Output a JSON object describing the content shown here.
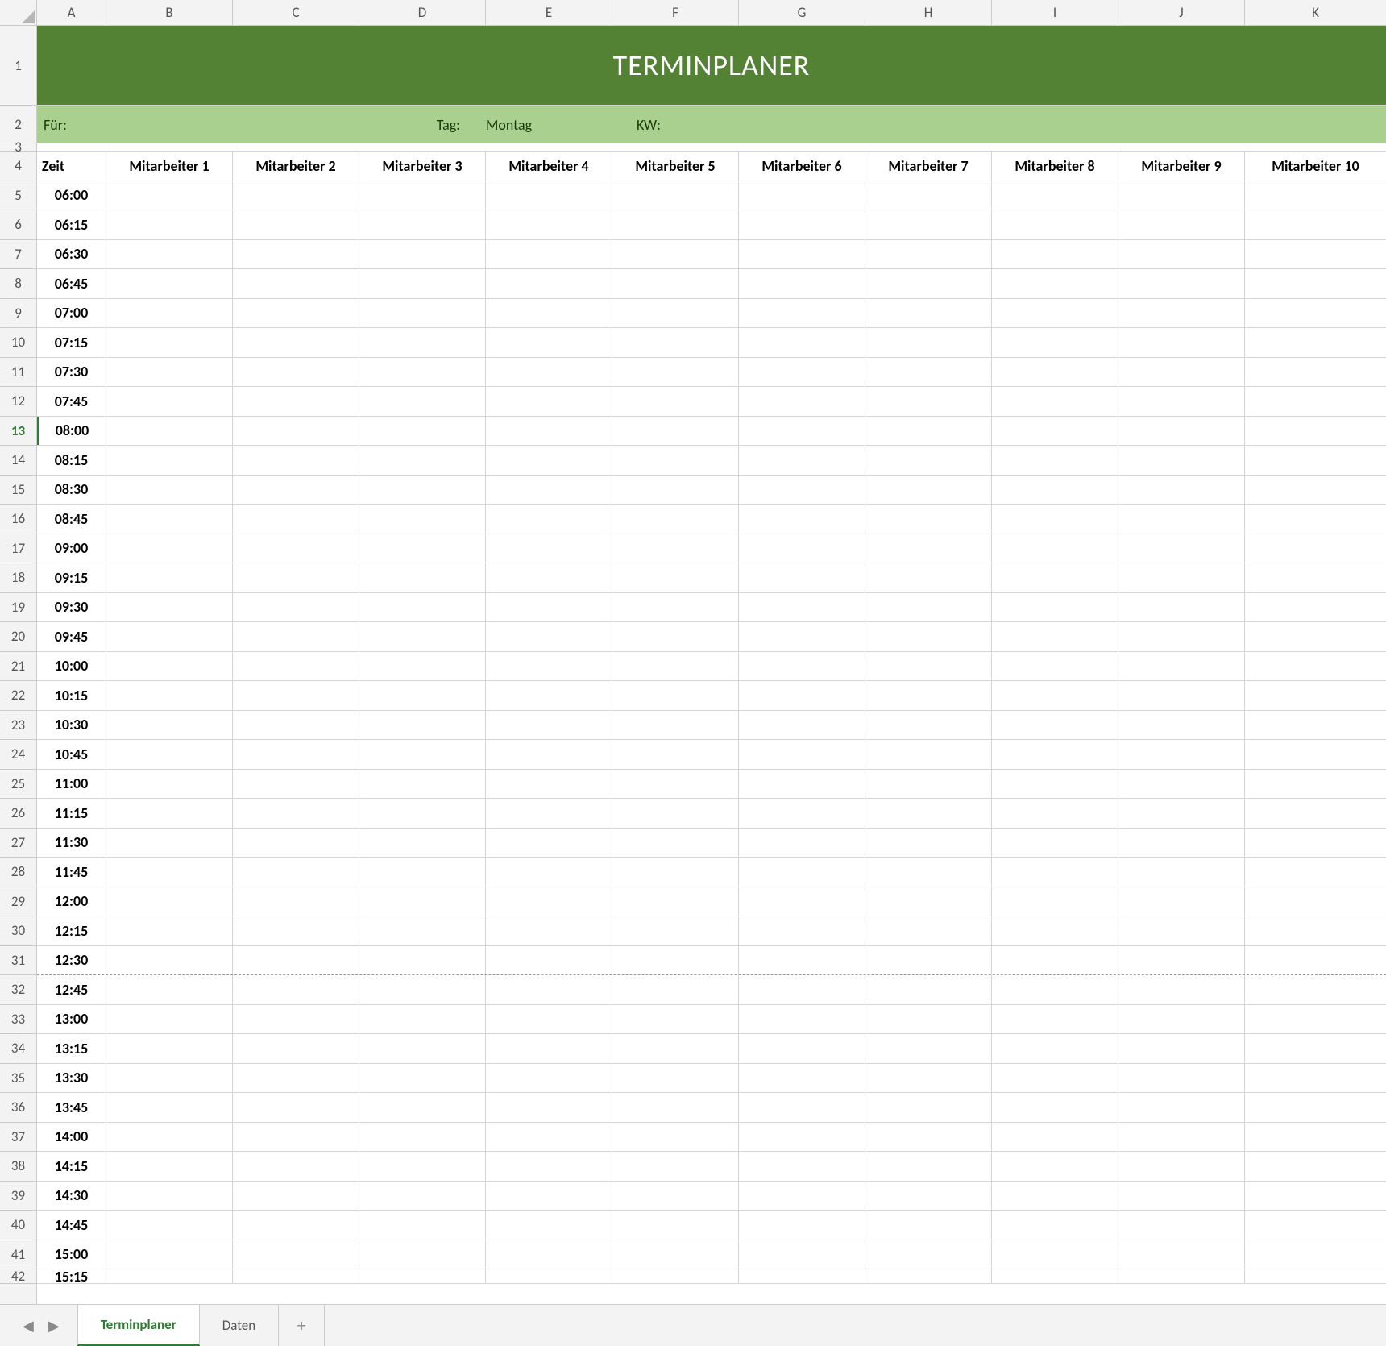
{
  "columns": [
    "A",
    "B",
    "C",
    "D",
    "E",
    "F",
    "G",
    "H",
    "I",
    "J",
    "K"
  ],
  "title": "TERMINPLANER",
  "info": {
    "fuer_label": "Für:",
    "fuer_value": "",
    "tag_label": "Tag:",
    "tag_value": "Montag",
    "kw_label": "KW:",
    "kw_value": ""
  },
  "headers": [
    "Zeit",
    "Mitarbeiter 1",
    "Mitarbeiter 2",
    "Mitarbeiter 3",
    "Mitarbeiter 4",
    "Mitarbeiter 5",
    "Mitarbeiter 6",
    "Mitarbeiter 7",
    "Mitarbeiter 8",
    "Mitarbeiter 9",
    "Mitarbeiter 10"
  ],
  "row_numbers_special": {
    "r1": "1",
    "r2": "2",
    "r3": "3",
    "r4": "4"
  },
  "selected_row": 13,
  "page_break_after_row": 31,
  "times": [
    {
      "row": 5,
      "t": "06:00"
    },
    {
      "row": 6,
      "t": "06:15"
    },
    {
      "row": 7,
      "t": "06:30"
    },
    {
      "row": 8,
      "t": "06:45"
    },
    {
      "row": 9,
      "t": "07:00"
    },
    {
      "row": 10,
      "t": "07:15"
    },
    {
      "row": 11,
      "t": "07:30"
    },
    {
      "row": 12,
      "t": "07:45"
    },
    {
      "row": 13,
      "t": "08:00"
    },
    {
      "row": 14,
      "t": "08:15"
    },
    {
      "row": 15,
      "t": "08:30"
    },
    {
      "row": 16,
      "t": "08:45"
    },
    {
      "row": 17,
      "t": "09:00"
    },
    {
      "row": 18,
      "t": "09:15"
    },
    {
      "row": 19,
      "t": "09:30"
    },
    {
      "row": 20,
      "t": "09:45"
    },
    {
      "row": 21,
      "t": "10:00"
    },
    {
      "row": 22,
      "t": "10:15"
    },
    {
      "row": 23,
      "t": "10:30"
    },
    {
      "row": 24,
      "t": "10:45"
    },
    {
      "row": 25,
      "t": "11:00"
    },
    {
      "row": 26,
      "t": "11:15"
    },
    {
      "row": 27,
      "t": "11:30"
    },
    {
      "row": 28,
      "t": "11:45"
    },
    {
      "row": 29,
      "t": "12:00"
    },
    {
      "row": 30,
      "t": "12:15"
    },
    {
      "row": 31,
      "t": "12:30"
    },
    {
      "row": 32,
      "t": "12:45"
    },
    {
      "row": 33,
      "t": "13:00"
    },
    {
      "row": 34,
      "t": "13:15"
    },
    {
      "row": 35,
      "t": "13:30"
    },
    {
      "row": 36,
      "t": "13:45"
    },
    {
      "row": 37,
      "t": "14:00"
    },
    {
      "row": 38,
      "t": "14:15"
    },
    {
      "row": 39,
      "t": "14:30"
    },
    {
      "row": 40,
      "t": "14:45"
    },
    {
      "row": 41,
      "t": "15:00"
    },
    {
      "row": 42,
      "t": "15:15"
    }
  ],
  "sheet_tabs": [
    {
      "name": "Terminplaner",
      "active": true
    },
    {
      "name": "Daten",
      "active": false
    }
  ],
  "add_tab_label": "+",
  "nav": {
    "prev": "◀",
    "next": "▶"
  }
}
